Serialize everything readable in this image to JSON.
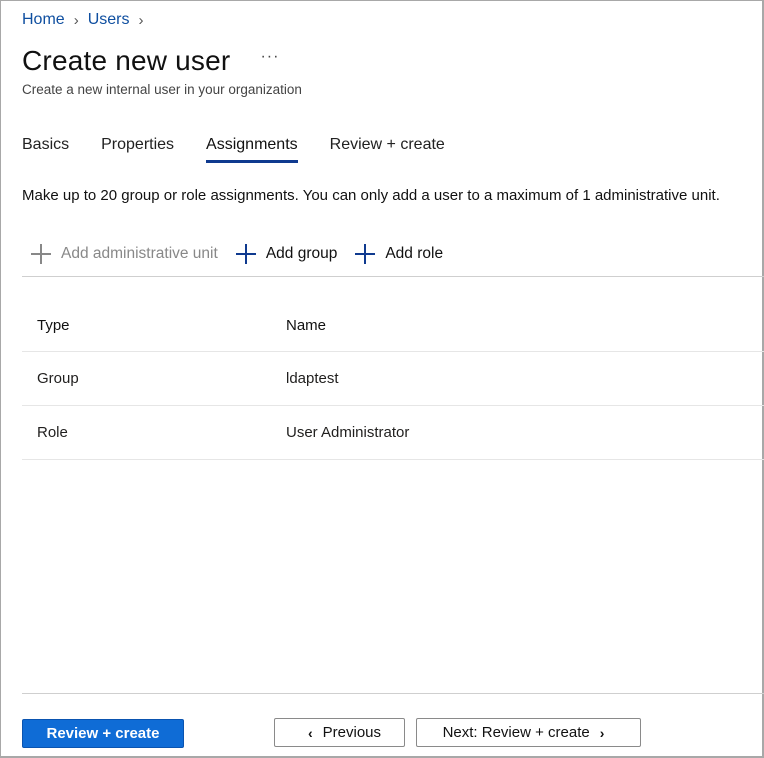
{
  "breadcrumb": {
    "items": [
      {
        "label": "Home"
      },
      {
        "label": "Users"
      }
    ],
    "separator": ">"
  },
  "header": {
    "title": "Create new user",
    "more_label": "···",
    "subtitle": "Create a new internal user in your organization"
  },
  "tabs": [
    {
      "label": "Basics",
      "active": false
    },
    {
      "label": "Properties",
      "active": false
    },
    {
      "label": "Assignments",
      "active": true
    },
    {
      "label": "Review + create",
      "active": false
    }
  ],
  "info_text": "Make up to 20 group or role assignments. You can only add a user to a maximum of 1 administrative unit.",
  "toolbar": {
    "add_admin_unit": {
      "label": "Add administrative unit",
      "icon": "plus-icon",
      "disabled": true
    },
    "add_group": {
      "label": "Add group",
      "icon": "plus-icon",
      "disabled": false
    },
    "add_role": {
      "label": "Add role",
      "icon": "plus-icon",
      "disabled": false
    }
  },
  "table": {
    "columns": [
      "Type",
      "Name"
    ],
    "rows": [
      {
        "type": "Group",
        "name": "ldaptest"
      },
      {
        "type": "Role",
        "name": "User Administrator"
      }
    ]
  },
  "footer": {
    "review_create_label": "Review + create",
    "previous_label": "Previous",
    "next_label": "Next: Review + create",
    "prev_icon": "chevron-left-icon",
    "next_icon": "chevron-right-icon"
  },
  "colors": {
    "accent": "#0f6cd6",
    "link": "#0f4fa0",
    "tab_underline": "#0f3a8f"
  }
}
